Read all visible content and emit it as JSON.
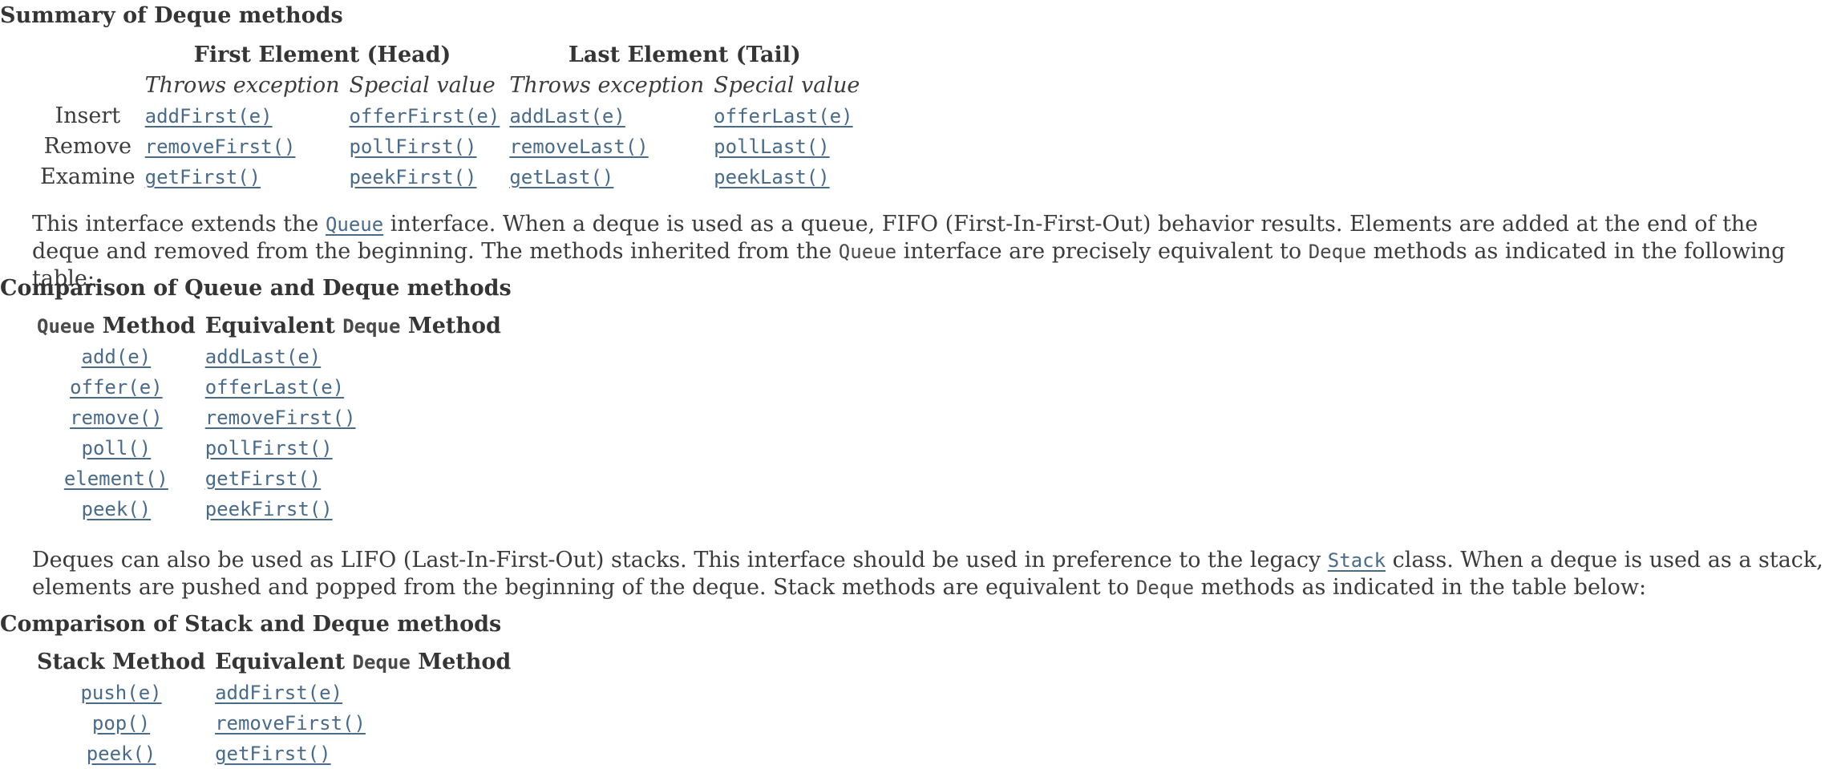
{
  "summary": {
    "caption": "Summary of Deque methods",
    "head_group": "First Element (Head)",
    "tail_group": "Last Element (Tail)",
    "sub_headers": [
      "Throws exception",
      "Special value",
      "Throws exception",
      "Special value"
    ],
    "rows": [
      {
        "label": "Insert",
        "cells": [
          "addFirst(e)",
          "offerFirst(e)",
          "addLast(e)",
          "offerLast(e)"
        ]
      },
      {
        "label": "Remove",
        "cells": [
          "removeFirst()",
          "pollFirst()",
          "removeLast()",
          "pollLast()"
        ]
      },
      {
        "label": "Examine",
        "cells": [
          "getFirst()",
          "peekFirst()",
          "getLast()",
          "peekLast()"
        ]
      }
    ]
  },
  "para1": {
    "t1": "This interface extends the ",
    "link": "Queue",
    "t2": " interface. When a deque is used as a queue, FIFO (First-In-First-Out) behavior results. Elements are added at the end of the deque and removed from the beginning. The methods inherited from the ",
    "code1": "Queue",
    "t3": " interface are precisely equivalent to ",
    "code2": "Deque",
    "t4": " methods as indicated in the following table:"
  },
  "queue_table": {
    "caption": "Comparison of Queue and Deque methods",
    "h1_code": "Queue",
    "h1_text": " Method",
    "h2_text1": "Equivalent ",
    "h2_code": "Deque",
    "h2_text2": " Method",
    "rows": [
      [
        "add(e)",
        "addLast(e)"
      ],
      [
        "offer(e)",
        "offerLast(e)"
      ],
      [
        "remove()",
        "removeFirst()"
      ],
      [
        "poll()",
        "pollFirst()"
      ],
      [
        "element()",
        "getFirst()"
      ],
      [
        "peek()",
        "peekFirst()"
      ]
    ]
  },
  "para2": {
    "t1": "Deques can also be used as LIFO (Last-In-First-Out) stacks. This interface should be used in preference to the legacy ",
    "link": "Stack",
    "t2": " class. When a deque is used as a stack, elements are pushed and popped from the beginning of the deque. Stack methods are equivalent to ",
    "code1": "Deque",
    "t3": " methods as indicated in the table below:"
  },
  "stack_table": {
    "caption": "Comparison of Stack and Deque methods",
    "h1_text": "Stack Method",
    "h2_text1": "Equivalent ",
    "h2_code": "Deque",
    "h2_text2": " Method",
    "rows": [
      [
        "push(e)",
        "addFirst(e)"
      ],
      [
        "pop()",
        "removeFirst()"
      ],
      [
        "peek()",
        "getFirst()"
      ]
    ]
  }
}
